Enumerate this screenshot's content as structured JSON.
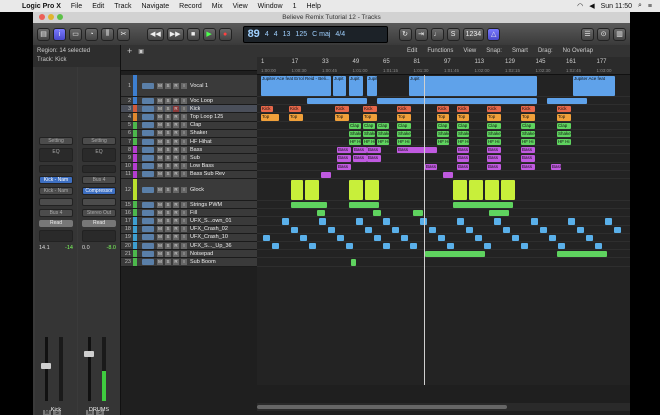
{
  "menubar": {
    "app": "Logic Pro X",
    "items": [
      "File",
      "Edit",
      "Track",
      "Navigate",
      "Record",
      "Mix",
      "View",
      "Window",
      "1",
      "Help"
    ],
    "clock": "Sun 11:50"
  },
  "window": {
    "title": "Believe Remix Tutorial 12 - Tracks"
  },
  "lcd": {
    "tempo": "89",
    "beat": "4",
    "sub": "4",
    "tick": "13",
    "bpm": "125",
    "key": "C maj",
    "signature": "4/4"
  },
  "inspector": {
    "region": "Region: 14 selected",
    "track": "Track: Kick"
  },
  "strips": [
    {
      "slots": [
        "Setting",
        "",
        "EQ",
        "",
        "",
        "Kick - Nam",
        "Kick - Nam",
        "Bus 4",
        "Read"
      ],
      "vol": "14.1",
      "peak": "-14",
      "name": "Kick"
    },
    {
      "slots": [
        "Setting",
        "",
        "EQ",
        "",
        "",
        "Bus 4",
        "Compressor",
        "Stereo Out",
        "Read"
      ],
      "vol": "0.0",
      "peak": "-8.0",
      "name": "DRUMS"
    }
  ],
  "edit": {
    "items": [
      "Edit",
      "Functions",
      "View"
    ],
    "snap_label": "Snap:",
    "snap": "Smart",
    "drag_label": "Drag:",
    "drag": "No Overlap"
  },
  "ruler": {
    "bars": [
      "1",
      "17",
      "33",
      "49",
      "65",
      "81",
      "97",
      "113",
      "129",
      "145",
      "161",
      "177"
    ],
    "times": [
      "1:00:00",
      "1:00:30",
      "1:00:45",
      "1:01:00",
      "1:01:15",
      "1:01:30",
      "1:01:45",
      "1:02:00",
      "1:02:15",
      "1:02:30",
      "1:02:45",
      "1:03:00"
    ]
  },
  "tracks": [
    {
      "n": "1",
      "name": "Vocal 1",
      "color": "#3d7fd1",
      "big": true
    },
    {
      "n": "2",
      "name": "Voc Loop",
      "color": "#3d7fd1"
    },
    {
      "n": "3",
      "name": "Kick",
      "color": "#d25a3a"
    },
    {
      "n": "4",
      "name": "Top Loop 125",
      "color": "#e0892e"
    },
    {
      "n": "5",
      "name": "Clap",
      "color": "#4cb84c"
    },
    {
      "n": "6",
      "name": "Shaker",
      "color": "#4cb84c"
    },
    {
      "n": "7",
      "name": "HF Hihat",
      "color": "#4cb84c"
    },
    {
      "n": "8",
      "name": "Bass",
      "color": "#b53dd1"
    },
    {
      "n": "9",
      "name": "Sub",
      "color": "#b53dd1"
    },
    {
      "n": "10",
      "name": "Low Bass",
      "color": "#b53dd1"
    },
    {
      "n": "11",
      "name": "Bass Sub Rev",
      "color": "#b53dd1"
    },
    {
      "n": "12",
      "name": "Glock",
      "color": "#b9e02e",
      "big": true
    },
    {
      "n": "15",
      "name": "Strings PWM",
      "color": "#4cb84c"
    },
    {
      "n": "16",
      "name": "Fill",
      "color": "#4cb84c"
    },
    {
      "n": "17",
      "name": "UFX_S...own_01",
      "color": "#3d9fd1"
    },
    {
      "n": "18",
      "name": "UFX_Crash_02",
      "color": "#3d9fd1"
    },
    {
      "n": "19",
      "name": "UFX_Crash_10",
      "color": "#3d9fd1"
    },
    {
      "n": "20",
      "name": "UFX_S..._Up_36",
      "color": "#3d9fd1"
    },
    {
      "n": "21",
      "name": "Noisepad",
      "color": "#4cb84c"
    },
    {
      "n": "23",
      "name": "Sub Boom",
      "color": "#4cb84c"
    }
  ],
  "region_labels": {
    "vocal": "Jupiter Ace feat Errol Reid - Beli...",
    "vocal_short": "Jupit",
    "vocal_end": "Jupiter Ace feat",
    "kick": "Kick",
    "top": "Top",
    "clap": "Clap",
    "shaker": "Shake",
    "hf": "HF Hi",
    "bass": "Bass"
  },
  "colors": {
    "vocal": "#5fa2ea",
    "kick": "#e8684a",
    "top": "#f0a03a",
    "green": "#5fd35f",
    "purple": "#c05ae0",
    "glock": "#c8ef3a",
    "blue": "#5ab0ea"
  }
}
